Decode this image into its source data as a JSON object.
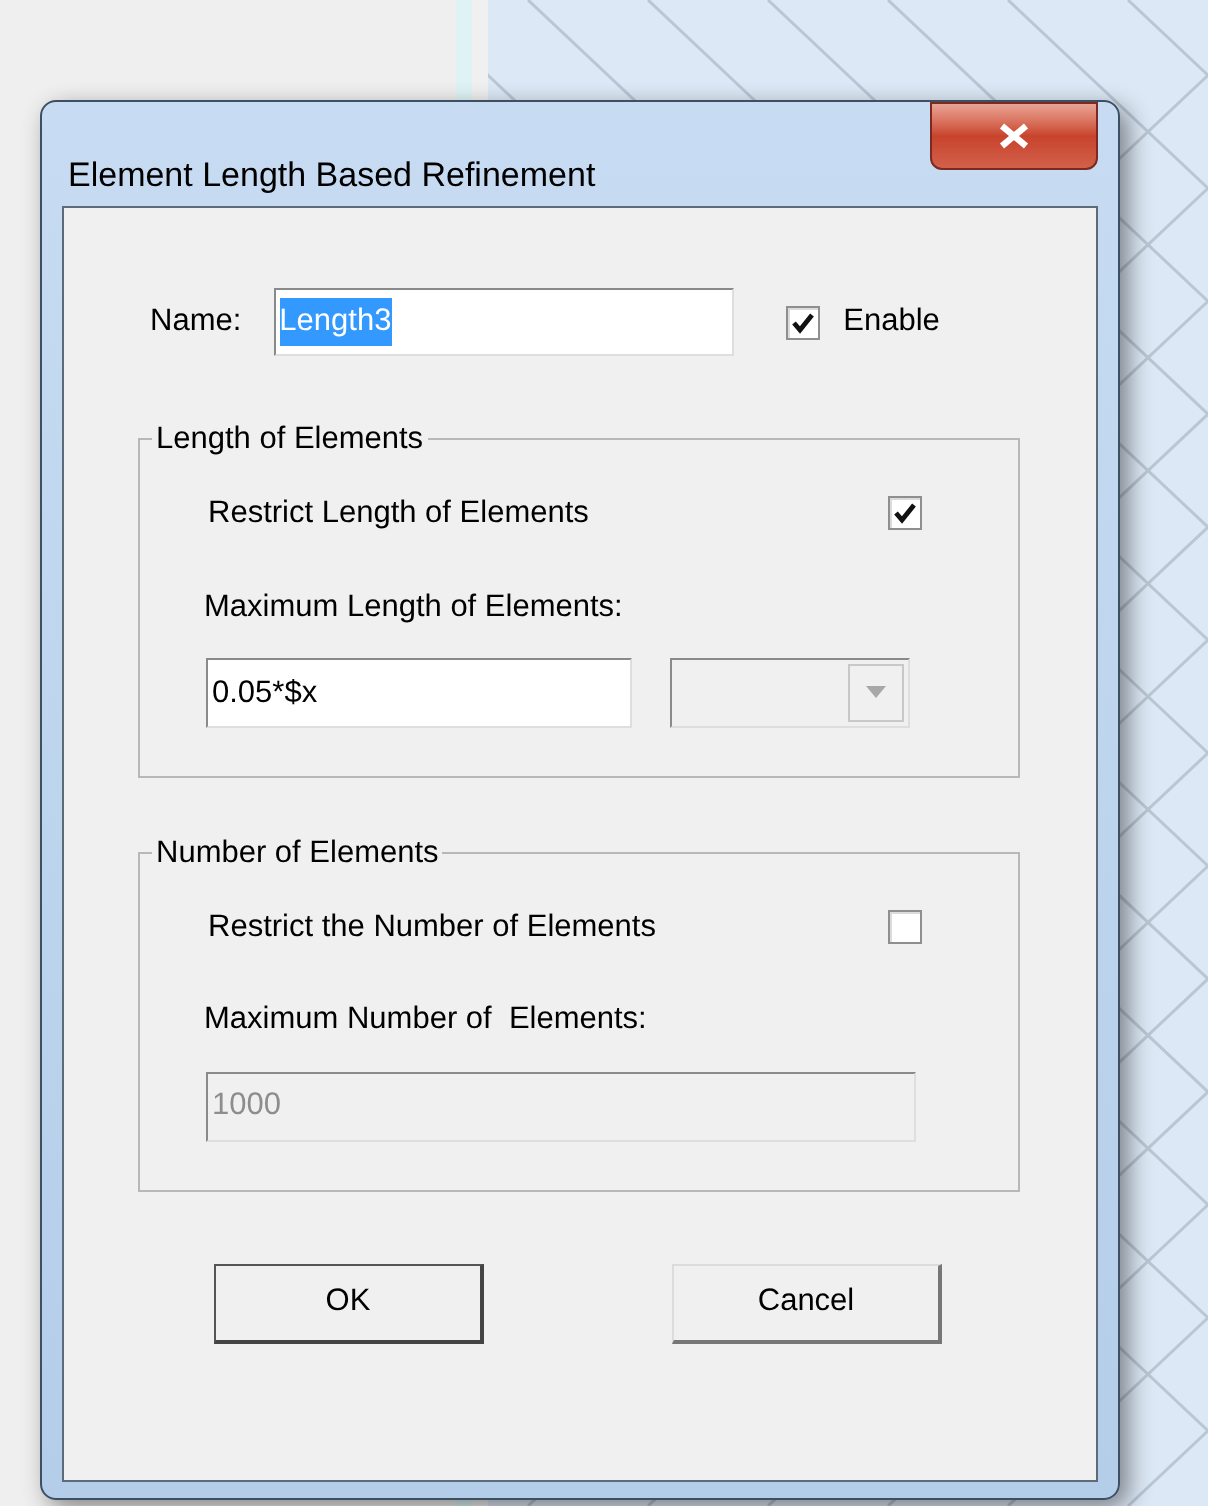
{
  "dialog": {
    "title": "Element Length Based Refinement",
    "name_field": {
      "label": "Name:",
      "value": "Length3",
      "selected": true
    },
    "enable": {
      "label": "Enable",
      "checked": true
    },
    "groups": [
      {
        "title": "Length of Elements",
        "restrict": {
          "label": "Restrict Length of Elements",
          "checked": true
        },
        "max_label": "Maximum Length of Elements:",
        "field": {
          "value": "0.05*$x",
          "disabled": false
        },
        "unit_dropdown": {
          "disabled": true
        }
      },
      {
        "title": "Number of Elements",
        "restrict": {
          "label": "Restrict the Number of Elements",
          "checked": false
        },
        "max_label": "Maximum Number of  Elements:",
        "field": {
          "value": "1000",
          "disabled": true
        }
      }
    ],
    "buttons": [
      {
        "label": "OK",
        "default": true
      },
      {
        "label": "Cancel",
        "default": false
      }
    ]
  }
}
